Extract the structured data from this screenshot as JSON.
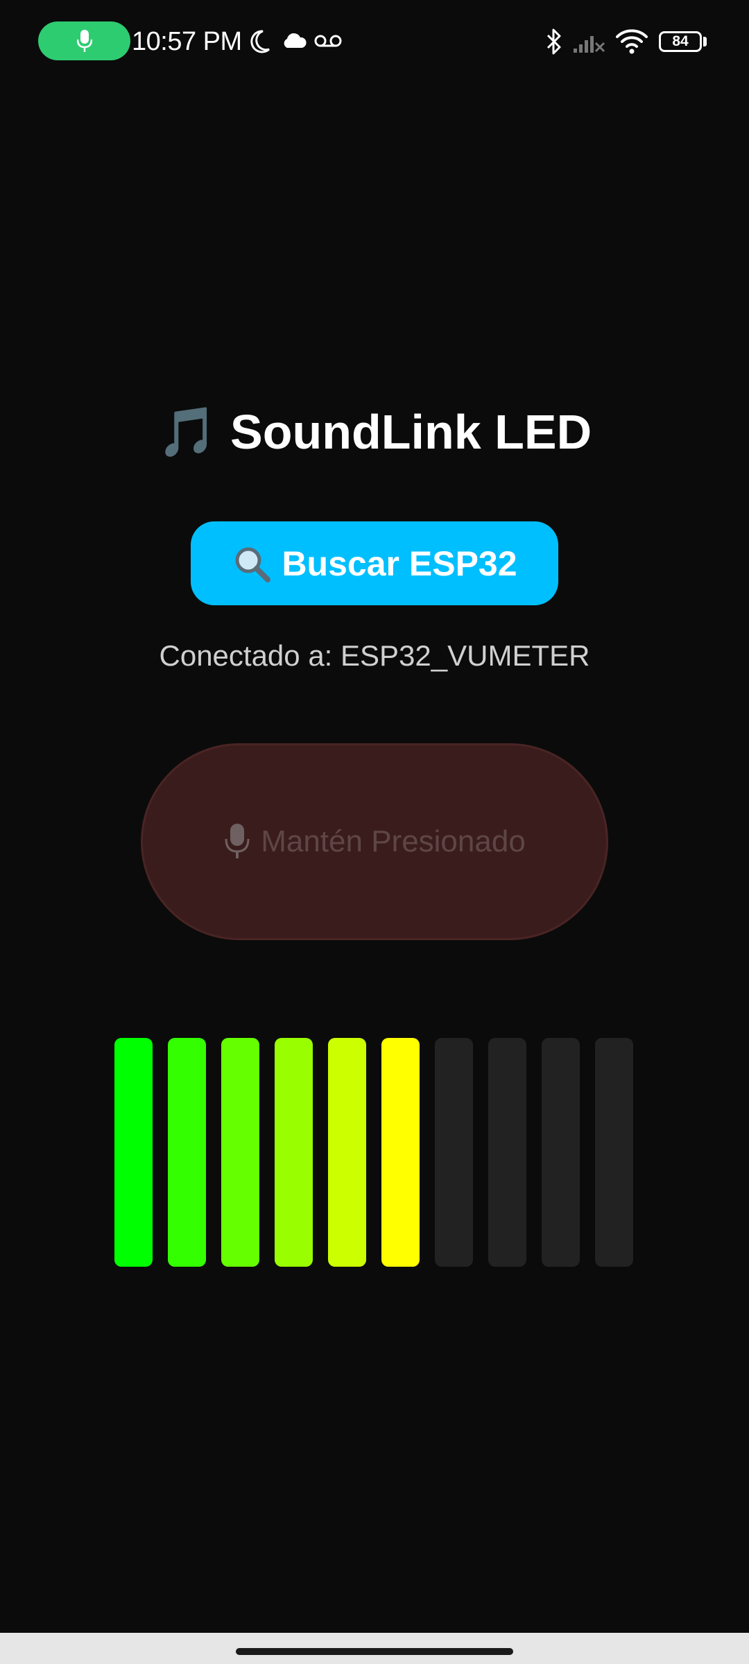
{
  "status_bar": {
    "time": "10:57 PM",
    "battery_level": "84",
    "icons": [
      "microphone-icon",
      "moon-icon",
      "cloud-icon",
      "voicemail-icon",
      "bluetooth-icon",
      "cellular-signal-icon",
      "wifi-icon",
      "battery-icon"
    ],
    "mic_pill_color": "#2ecc71"
  },
  "app": {
    "title_emoji": "🎵",
    "title": "SoundLink LED",
    "scan_button": {
      "icon": "magnifier-icon",
      "label": "Buscar ESP32",
      "color": "#00bfff"
    },
    "connection_status": "Conectado a: ESP32_VUMETER",
    "ptt_button": {
      "icon": "studio-microphone-icon",
      "label": "Mantén Presionado",
      "color": "#3b1c1c"
    },
    "vu_meter": {
      "total_bars": 10,
      "active_bars": 6,
      "bar_colors": [
        "#00ff00",
        "#33ff00",
        "#66ff00",
        "#99ff00",
        "#ccff00",
        "#ffff00",
        "#222222",
        "#222222",
        "#222222",
        "#222222"
      ]
    }
  },
  "nav": {
    "handle_color": "#1a1a1a"
  }
}
